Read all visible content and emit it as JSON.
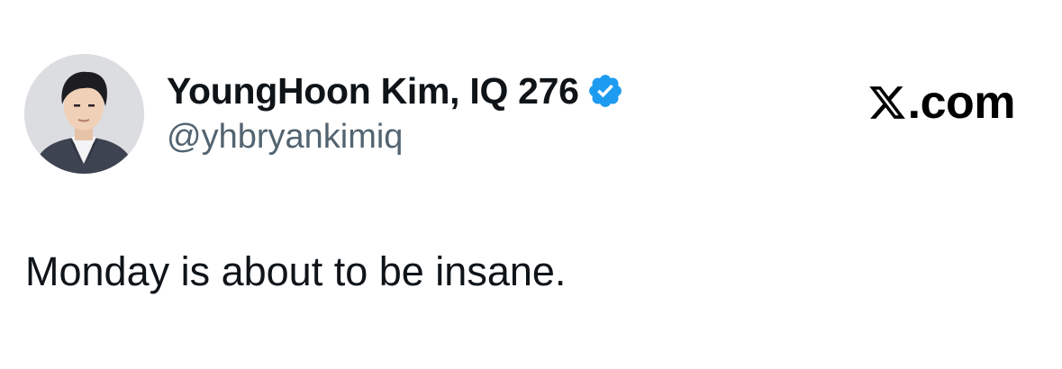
{
  "author": {
    "display_name": "YoungHoon Kim, IQ 276",
    "handle": "@yhbryankimiq",
    "verified": true,
    "avatar_icon": "profile-photo"
  },
  "brand": {
    "logo_icon": "x-logo-icon",
    "domain_suffix": ".com"
  },
  "post": {
    "text": "Monday is about to be insane."
  },
  "colors": {
    "verified_badge": "#1d9bf0",
    "handle_gray": "#536471",
    "text": "#0f1419"
  }
}
